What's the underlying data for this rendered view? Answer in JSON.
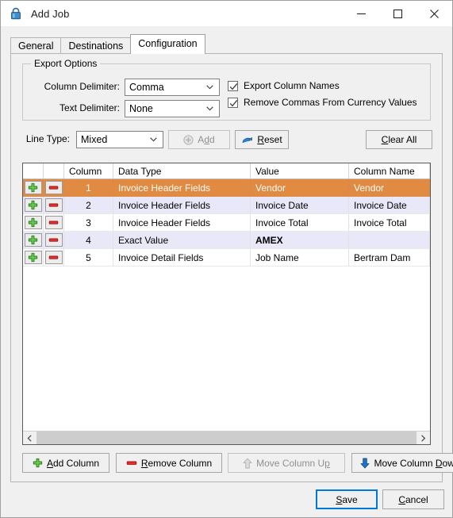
{
  "window": {
    "title": "Add Job",
    "icon": "lock-icon",
    "controls": {
      "minimize": "—",
      "maximize": "☐",
      "close": "✕"
    }
  },
  "tabs": [
    {
      "label": "General",
      "active": false
    },
    {
      "label": "Destinations",
      "active": false
    },
    {
      "label": "Configuration",
      "active": true
    }
  ],
  "export_options": {
    "legend": "Export Options",
    "column_delimiter": {
      "label": "Column Delimiter:",
      "value": "Comma"
    },
    "text_delimiter": {
      "label": "Text Delimiter:",
      "value": "None"
    },
    "export_column_names": {
      "label": "Export Column Names",
      "checked": true
    },
    "remove_commas": {
      "label": "Remove Commas From Currency Values",
      "checked": true
    }
  },
  "line_type": {
    "label": "Line Type:",
    "value": "Mixed",
    "add_button": {
      "label": "Add",
      "enabled": false
    },
    "reset_button": {
      "label": "Reset",
      "enabled": true
    },
    "clear_all_button": {
      "label": "Clear All",
      "enabled": true
    }
  },
  "grid": {
    "columns": [
      "",
      "",
      "Column",
      "Data Type",
      "Value",
      "Column Name"
    ],
    "rows": [
      {
        "column": "1",
        "data_type": "Invoice Header Fields",
        "value": "Vendor",
        "column_name": "Vendor",
        "selected": true,
        "bold_value": false
      },
      {
        "column": "2",
        "data_type": "Invoice Header Fields",
        "value": "Invoice Date",
        "column_name": "Invoice Date",
        "selected": false,
        "bold_value": false
      },
      {
        "column": "3",
        "data_type": "Invoice Header Fields",
        "value": "Invoice Total",
        "column_name": "Invoice Total",
        "selected": false,
        "bold_value": false
      },
      {
        "column": "4",
        "data_type": "Exact Value",
        "value": "AMEX",
        "column_name": "",
        "selected": false,
        "bold_value": true
      },
      {
        "column": "5",
        "data_type": "Invoice Detail Fields",
        "value": "Job Name",
        "column_name": "Bertram Dam",
        "selected": false,
        "bold_value": false
      }
    ]
  },
  "actions": {
    "add_column": {
      "label": "Add Column",
      "enabled": true,
      "icon": "plus-icon"
    },
    "remove_column": {
      "label": "Remove Column",
      "enabled": true,
      "icon": "minus-icon"
    },
    "move_column_up": {
      "label": "Move Column Up",
      "enabled": false,
      "icon": "arrow-up-icon"
    },
    "move_column_down": {
      "label": "Move Column Down",
      "enabled": true,
      "icon": "arrow-down-icon"
    }
  },
  "footer": {
    "save": "Save",
    "cancel": "Cancel"
  },
  "colors": {
    "selected_row": "#e08a42",
    "alt_row": "#e8e8f8",
    "accent": "#0078d7",
    "plus_green": "#5cc24a",
    "minus_red": "#e02b2b",
    "icon_blue": "#1f72c8"
  }
}
